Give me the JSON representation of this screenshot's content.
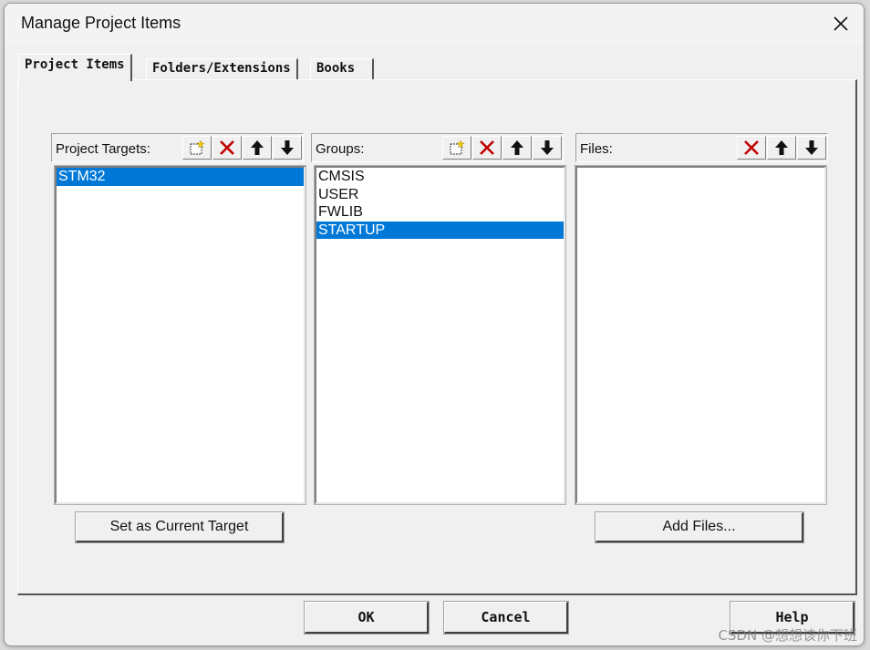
{
  "window": {
    "title": "Manage Project Items"
  },
  "tabs": [
    {
      "label": "Project Items",
      "active": true
    },
    {
      "label": "Folders/Extensions",
      "active": false
    },
    {
      "label": "Books",
      "active": false
    }
  ],
  "targets": {
    "label": "Project Targets:",
    "items": [
      {
        "label": "STM32",
        "selected": true
      }
    ],
    "action_button": "Set as Current Target"
  },
  "groups": {
    "label": "Groups:",
    "items": [
      {
        "label": "CMSIS",
        "selected": false
      },
      {
        "label": "USER",
        "selected": false
      },
      {
        "label": "FWLIB",
        "selected": false
      },
      {
        "label": "STARTUP",
        "selected": true
      }
    ]
  },
  "files": {
    "label": "Files:",
    "items": [],
    "action_button": "Add Files..."
  },
  "footer": {
    "ok_label": "OK",
    "cancel_label": "Cancel",
    "help_label": "Help"
  },
  "icons": {
    "new": "new-item-icon",
    "delete": "delete-x-icon",
    "move_up": "arrow-up-icon",
    "move_down": "arrow-down-icon",
    "close": "close-icon"
  },
  "colors": {
    "selection": "#0078d7",
    "delete_icon": "#c00000"
  },
  "watermark": "CSDN @想想该你下班"
}
